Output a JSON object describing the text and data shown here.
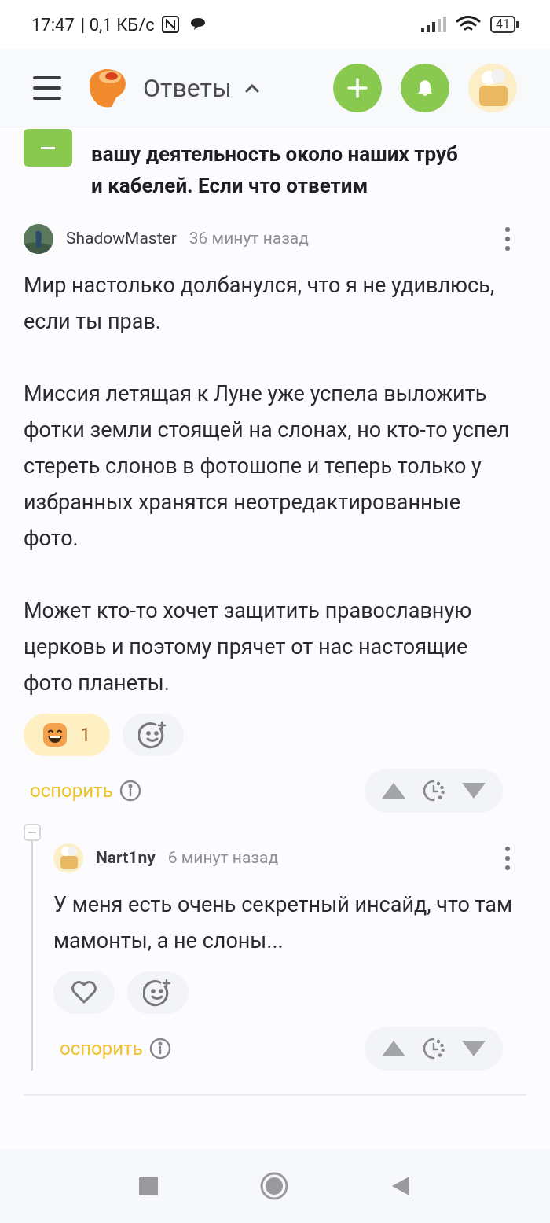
{
  "status_bar": {
    "time": "17:47",
    "speed": "| 0,1 КБ/с",
    "battery": "41"
  },
  "header": {
    "title": "Ответы",
    "expanded": true
  },
  "question": {
    "lines": [
      "вашу деятельность около наших труб",
      "и кабелей. Если что ответим"
    ],
    "collapsed": false
  },
  "comments": [
    {
      "author": "ShadowMaster",
      "time": "36 минут назад",
      "paragraphs": [
        "Мир настолько долбанулся, что я не удивлюсь, если ты прав.",
        "Миссия летящая к Луне уже успела выложить фотки земли стоящей на слонах, но кто-то успел стереть слонов в фотошопе и теперь только у избранных хранятся неотредактированные фото.",
        "Может кто-то хочет защитить православную церковь и поэтому прячет от нас настоящие фото планеты."
      ],
      "reaction": {
        "kind": "emoji",
        "count": "1"
      },
      "dispute": "оспорить",
      "replies": [
        {
          "author": "Nart1ny",
          "time": "6 минут назад",
          "paragraphs": [
            "У меня есть очень секретный инсайд, что там мамонты, а не слоны..."
          ],
          "reaction": {
            "kind": "like"
          },
          "dispute": "оспорить"
        }
      ]
    }
  ]
}
